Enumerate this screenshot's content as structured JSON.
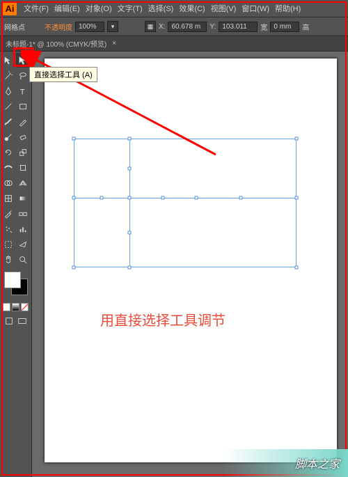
{
  "app": {
    "logo": "Ai"
  },
  "menu": {
    "file": "文件(F)",
    "edit": "编辑(E)",
    "object": "对象(O)",
    "text": "文字(T)",
    "select": "选择(S)",
    "effect": "效果(C)",
    "view": "视图(V)",
    "window": "窗口(W)",
    "help": "帮助(H)"
  },
  "options": {
    "anchor_label": "网格点",
    "opacity_label": "不透明度",
    "zoom": "100%",
    "x_label": "X:",
    "x_value": "60.678 m",
    "y_label": "Y:",
    "y_value": "103.011",
    "w_label": "宽",
    "w_value": "0 mm",
    "h_label": "高"
  },
  "doc_tab": {
    "title": "未标题-1* @ 100% (CMYK/预览)",
    "close": "×"
  },
  "tooltip": "直接选择工具 (A)",
  "canvas": {
    "caption": "用直接选择工具调节"
  },
  "colors": {
    "fill": "#ffffff",
    "stroke": "#000000"
  },
  "watermark": "脚本之家",
  "tools": {
    "selection": "selection",
    "direct_select": "direct-select",
    "wand": "magic-wand",
    "lasso": "lasso",
    "pen": "pen",
    "type": "type",
    "line": "line-segment",
    "rect": "rectangle",
    "brush": "paintbrush",
    "pencil": "pencil",
    "blob": "blob-brush",
    "eraser": "eraser",
    "rotate": "rotate",
    "scale": "scale",
    "width": "width",
    "warp": "free-transform",
    "shape_builder": "shape-builder",
    "perspective": "perspective-grid",
    "mesh": "mesh",
    "gradient": "gradient",
    "eyedrop": "eyedropper",
    "blend": "blend",
    "symbol": "symbol-sprayer",
    "graph": "column-graph",
    "artboard": "artboard",
    "slice": "slice",
    "hand": "hand",
    "zoom": "zoom"
  }
}
